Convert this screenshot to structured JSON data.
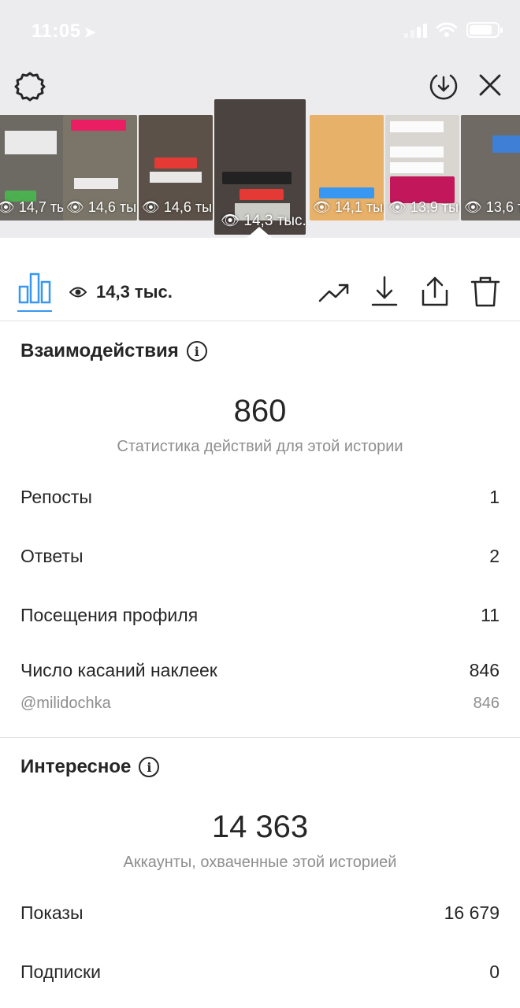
{
  "status_bar": {
    "time": "11:05",
    "location_arrow": "➤"
  },
  "header": {
    "settings_icon": "gear-icon",
    "download_icon": "download-circle-icon",
    "close_icon": "close-icon"
  },
  "thumbnails": [
    {
      "views": "14,7 тыс.",
      "bg": "#6d6a63",
      "active": false
    },
    {
      "views": "14,6 тыс.",
      "bg": "#7a7568",
      "active": false
    },
    {
      "views": "14,6 тыс.",
      "bg": "#5b5148",
      "active": false
    },
    {
      "views": "14,3 тыс.",
      "bg": "#4b4340",
      "active": true
    },
    {
      "views": "14,1 тыс.",
      "bg": "#e8b16a",
      "active": false
    },
    {
      "views": "13,9 тыс.",
      "bg": "#d9d6d2",
      "active": false
    },
    {
      "views": "13,6 тыс.",
      "bg": "#6f6a64",
      "active": false
    }
  ],
  "toolbar": {
    "views_total": "14,3 тыс.",
    "icons": [
      "trend-icon",
      "download-icon",
      "share-icon",
      "trash-icon"
    ]
  },
  "interactions": {
    "title": "Взаимодействия",
    "total": "860",
    "caption": "Статистика действий для этой истории",
    "rows": [
      {
        "label": "Репосты",
        "value": "1"
      },
      {
        "label": "Ответы",
        "value": "2"
      },
      {
        "label": "Посещения профиля",
        "value": "11"
      },
      {
        "label": "Число касаний наклеек",
        "value": "846"
      }
    ],
    "sticker_row": {
      "label": "@milidochka",
      "value": "846"
    }
  },
  "discovery": {
    "title": "Интересное",
    "total": "14 363",
    "caption": "Аккаунты, охваченные этой историей",
    "rows": [
      {
        "label": "Показы",
        "value": "16 679"
      },
      {
        "label": "Подписки",
        "value": "0"
      }
    ]
  },
  "colors": {
    "accent": "#3897f0",
    "text": "#262626",
    "muted": "#8e8e8e",
    "top_bg": "#ececee"
  }
}
